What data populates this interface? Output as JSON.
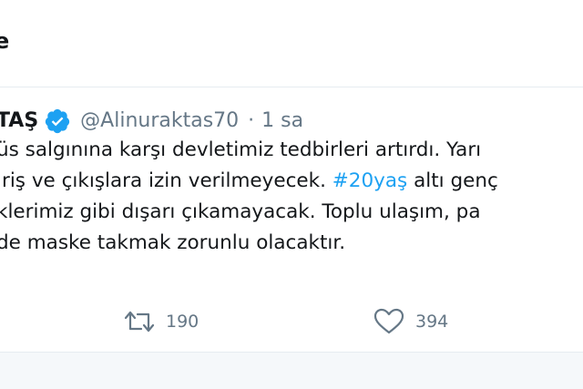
{
  "header": {
    "title_fragment": "e"
  },
  "tweet": {
    "author_name": "TAŞ",
    "verified": true,
    "handle": "@Alinuraktas70",
    "separator": "·",
    "time": "1 sa",
    "lines": [
      {
        "before": "üs salgınına karşı devletimiz tedbirleri artırdı. Yarı",
        "hashtag": "",
        "after": ""
      },
      {
        "before": "iriş ve çıkışlara izin verilmeyecek. ",
        "hashtag": "#20yaş",
        "after": " altı genç"
      },
      {
        "before": "klerimiz gibi dışarı çıkamayacak. Toplu ulaşım, pa",
        "hashtag": "",
        "after": ""
      },
      {
        "before": "de maske takmak zorunlu olacaktır.",
        "hashtag": "",
        "after": ""
      }
    ],
    "retweet_count": "190",
    "like_count": "394"
  },
  "icons": {
    "verified": "verified-badge-icon",
    "retweet": "retweet-icon",
    "like": "heart-icon"
  },
  "colors": {
    "text": "#14171a",
    "muted": "#657786",
    "accent": "#1da1f2",
    "divider": "#e6ecf0"
  }
}
